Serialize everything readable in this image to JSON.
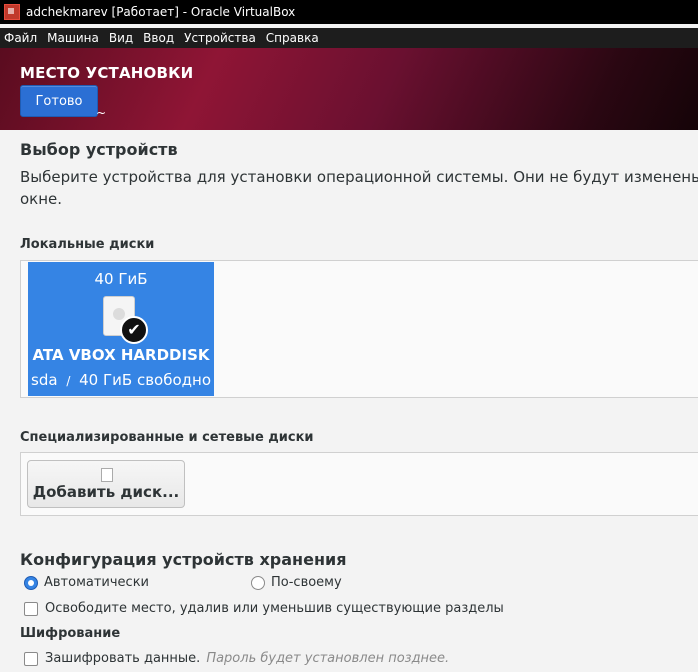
{
  "window": {
    "title": "adchekmarev [Работает] - Oracle VirtualBox"
  },
  "menu": {
    "items": [
      "Файл",
      "Машина",
      "Вид",
      "Ввод",
      "Устройства",
      "Справка"
    ]
  },
  "header": {
    "title": "МЕСТО УСТАНОВКИ",
    "done_label": "Готово"
  },
  "devices": {
    "title": "Выбор устройств",
    "description_line1": "Выберите устройства для установки операционной системы. Они не будут изменены д",
    "description_line2": "окне."
  },
  "local_disks": {
    "heading": "Локальные диски",
    "disk": {
      "size": "40 ГиБ",
      "name": "ATA VBOX HARDDISK",
      "device": "sda",
      "separator": "/",
      "free": "40 ГиБ свободно",
      "selected": true
    }
  },
  "network_disks": {
    "heading": "Специализированные и сетевые диски",
    "add_label": "Добавить диск..."
  },
  "storage_config": {
    "title": "Конфигурация устройств хранения",
    "automatic_label": "Автоматически",
    "custom_label": "По-своему",
    "selected": "automatic",
    "free_space_label": "Освободите место, удалив или уменьшив существующие разделы"
  },
  "encryption": {
    "heading": "Шифрование",
    "encrypt_label": "Зашифровать данные.",
    "hint": "Пароль будет установлен позднее."
  },
  "colors": {
    "accent": "#3584e4",
    "header_bg": "#8f1535",
    "button": "#2b6fd4"
  },
  "icons": {
    "app": "virtualbox-icon",
    "disk": "harddisk-icon",
    "check": "checkmark-icon",
    "add_disk": "disk-icon"
  }
}
